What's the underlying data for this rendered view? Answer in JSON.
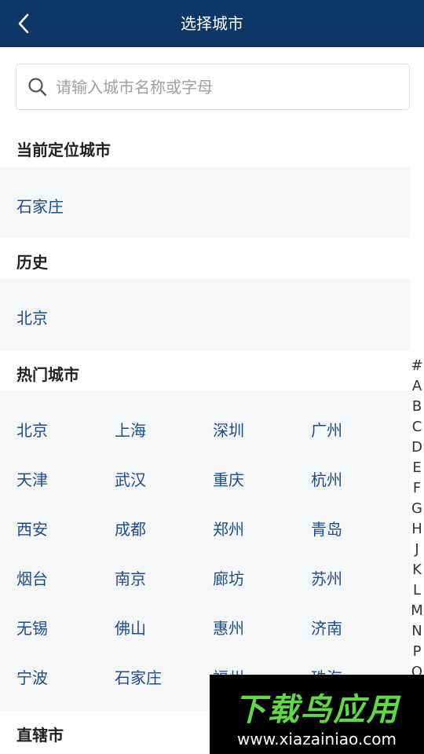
{
  "header": {
    "title": "选择城市"
  },
  "search": {
    "placeholder": "请输入城市名称或字母",
    "value": ""
  },
  "sections": {
    "current": {
      "title": "当前定位城市",
      "city": "石家庄"
    },
    "history": {
      "title": "历史",
      "city": "北京"
    },
    "hot": {
      "title": "热门城市",
      "cities": [
        "北京",
        "上海",
        "深圳",
        "广州",
        "天津",
        "武汉",
        "重庆",
        "杭州",
        "西安",
        "成都",
        "郑州",
        "青岛",
        "烟台",
        "南京",
        "廊坊",
        "苏州",
        "无锡",
        "佛山",
        "惠州",
        "济南",
        "宁波",
        "石家庄",
        "福州",
        "珠海"
      ]
    },
    "municipality": {
      "title": "直辖市"
    }
  },
  "index_letters": [
    "#",
    "A",
    "B",
    "C",
    "D",
    "E",
    "F",
    "G",
    "H",
    "J",
    "K",
    "L",
    "M",
    "N",
    "P",
    "Q"
  ],
  "watermark": {
    "brand": "下载鸟应用",
    "url": "www.xiazainiao.com"
  },
  "colors": {
    "header_bg": "#0c3766",
    "city_text": "#1f4e86",
    "block_bg": "#f5f6f8",
    "watermark_green": "#62d845"
  }
}
